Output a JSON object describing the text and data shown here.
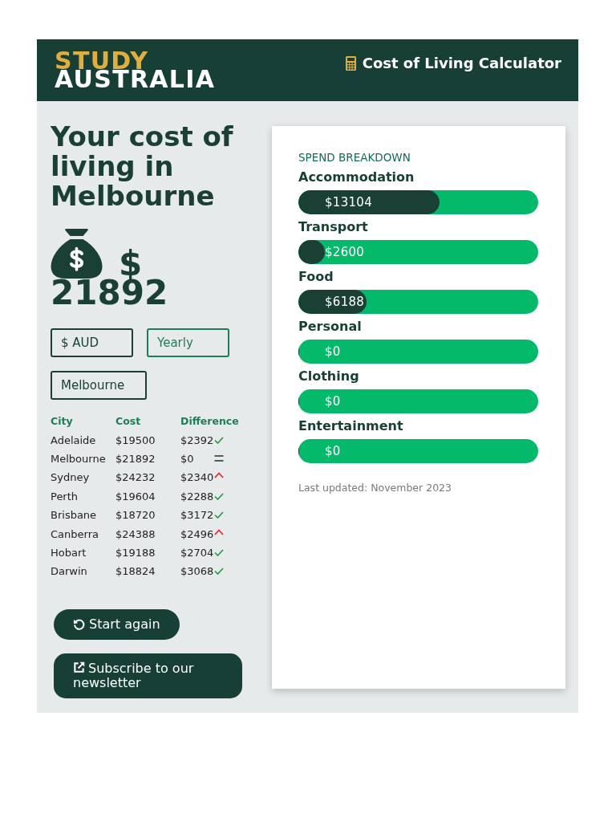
{
  "header": {
    "logo": {
      "line_1": "STUDY",
      "line_2": "AUSTRALIA"
    },
    "title": "Cost of Living Calculator"
  },
  "summary": {
    "heading": "Your cost of living in Melbourne",
    "currency_symbol": "$",
    "amount": "21892"
  },
  "dropdowns": [
    {
      "value": "$ AUD",
      "focused": false
    },
    {
      "value": "Yearly",
      "focused": true
    },
    {
      "value": "Melbourne",
      "focused": false
    }
  ],
  "comparison_table": {
    "columns": [
      "City",
      "Cost",
      "Difference"
    ],
    "rows": [
      {
        "city": "Adelaide",
        "cost": "$19500",
        "difference": "$2392",
        "kind": "cheaper"
      },
      {
        "city": "Melbourne",
        "cost": "$21892",
        "difference": "$0",
        "kind": "same"
      },
      {
        "city": "Sydney",
        "cost": "$24232",
        "difference": "$2340",
        "kind": "dearer"
      },
      {
        "city": "Perth",
        "cost": "$19604",
        "difference": "$2288",
        "kind": "cheaper"
      },
      {
        "city": "Brisbane",
        "cost": "$18720",
        "difference": "$3172",
        "kind": "cheaper"
      },
      {
        "city": "Canberra",
        "cost": "$24388",
        "difference": "$2496",
        "kind": "dearer"
      },
      {
        "city": "Hobart",
        "cost": "$19188",
        "difference": "$2704",
        "kind": "cheaper"
      },
      {
        "city": "Darwin",
        "cost": "$18824",
        "difference": "$3068",
        "kind": "cheaper"
      }
    ]
  },
  "buttons": [
    {
      "label": "Start again",
      "kind": "restart"
    },
    {
      "label": "Subscribe to our newsletter",
      "kind": "subscribe"
    }
  ],
  "spend_breakdown": {
    "heading": "SPEND BREAKDOWN",
    "items": [
      {
        "label": "Accommodation",
        "value": "$13104",
        "level": 0.59
      },
      {
        "label": "Transport",
        "value": "$2600",
        "level": 0.11
      },
      {
        "label": "Food",
        "value": "$6188",
        "level": 0.285
      },
      {
        "label": "Personal",
        "value": "$0",
        "level": 0
      },
      {
        "label": "Clothing",
        "value": "$0",
        "level": 0
      },
      {
        "label": "Entertainment",
        "value": "$0",
        "level": 0
      }
    ],
    "footnote": "Last updated: November 2023"
  }
}
